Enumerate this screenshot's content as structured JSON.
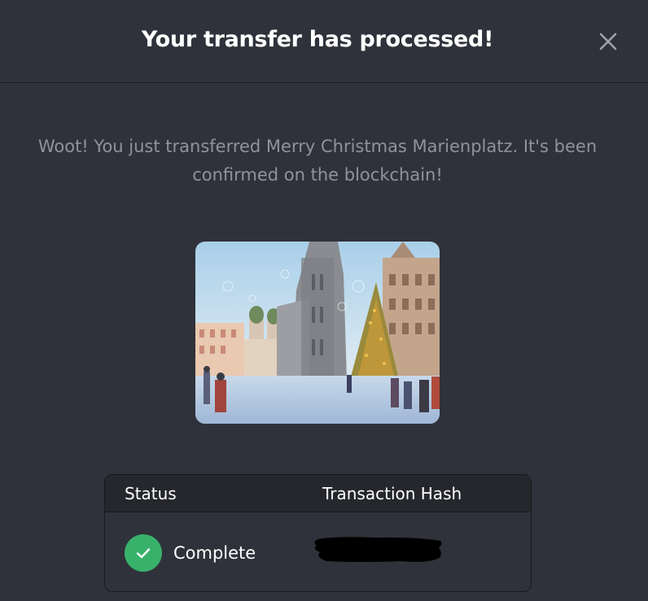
{
  "modal": {
    "title": "Your transfer has processed!",
    "close_icon": "close-icon",
    "message": "Woot! You just transferred Merry Christmas Marienplatz. It's been confirmed on the blockchain!",
    "nft_image_icon": "nft-painting-image"
  },
  "table": {
    "headers": {
      "status": "Status",
      "hash": "Transaction Hash"
    },
    "row": {
      "status": "Complete",
      "status_icon": "check-circle-icon",
      "hash_redacted": true
    }
  },
  "colors": {
    "background": "#2f323a",
    "title": "#ffffff",
    "message": "#8f939b",
    "success": "#38b26b",
    "table_header_bg": "#25272c"
  }
}
